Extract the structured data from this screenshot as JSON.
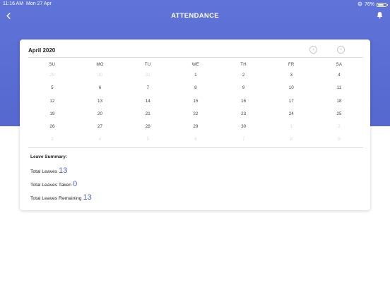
{
  "status_bar": {
    "time": "11:16 AM",
    "date": "Mon 27 Apr",
    "battery_text": "76%",
    "battery_level": 0.76
  },
  "nav": {
    "title": "ATTENDANCE",
    "back_icon": "chevron-left-icon",
    "bell_icon": "bell-icon"
  },
  "calendar": {
    "month_label": "April 2020",
    "weekdays": [
      "SU",
      "MO",
      "TU",
      "WE",
      "TH",
      "FR",
      "SA"
    ],
    "weeks": [
      [
        {
          "d": "29",
          "out": true
        },
        {
          "d": "30",
          "out": true
        },
        {
          "d": "31",
          "out": true
        },
        {
          "d": "1"
        },
        {
          "d": "2"
        },
        {
          "d": "3"
        },
        {
          "d": "4"
        }
      ],
      [
        {
          "d": "5"
        },
        {
          "d": "6"
        },
        {
          "d": "7"
        },
        {
          "d": "8"
        },
        {
          "d": "9"
        },
        {
          "d": "10"
        },
        {
          "d": "11"
        }
      ],
      [
        {
          "d": "12"
        },
        {
          "d": "13"
        },
        {
          "d": "14"
        },
        {
          "d": "15"
        },
        {
          "d": "16"
        },
        {
          "d": "17"
        },
        {
          "d": "18"
        }
      ],
      [
        {
          "d": "19"
        },
        {
          "d": "20"
        },
        {
          "d": "21"
        },
        {
          "d": "22"
        },
        {
          "d": "23"
        },
        {
          "d": "24"
        },
        {
          "d": "25"
        }
      ],
      [
        {
          "d": "26"
        },
        {
          "d": "27"
        },
        {
          "d": "28"
        },
        {
          "d": "29"
        },
        {
          "d": "30"
        },
        {
          "d": "1",
          "out": true
        },
        {
          "d": "2",
          "out": true
        }
      ],
      [
        {
          "d": "3",
          "out": true
        },
        {
          "d": "4",
          "out": true
        },
        {
          "d": "5",
          "out": true
        },
        {
          "d": "6",
          "out": true
        },
        {
          "d": "7",
          "out": true
        },
        {
          "d": "8",
          "out": true
        },
        {
          "d": "9",
          "out": true
        }
      ]
    ]
  },
  "summary": {
    "title": "Leave Summary:",
    "total_label": "Total Leaves",
    "total_value": "13",
    "taken_label": "Total Leaves Taken",
    "taken_value": "0",
    "remaining_label": "Total Leaves Remaining",
    "remaining_value": "13"
  },
  "colors": {
    "header": "#5b6fd6",
    "accent": "#4e63c8"
  }
}
